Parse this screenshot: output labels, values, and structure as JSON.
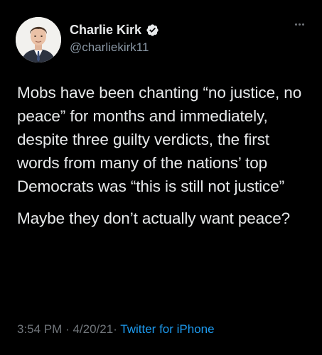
{
  "author": {
    "display_name": "Charlie Kirk",
    "handle": "@charliekirk11",
    "verified": true
  },
  "tweet": {
    "paragraphs": [
      "Mobs have been chanting “no justice, no peace” for months and immediately, despite three guilty verdicts, the first words from many of the nations’ top Democrats was “this is still not justice”",
      "Maybe they don’t actually want peace?"
    ],
    "time": "3:54 PM",
    "date": "4/20/21",
    "separator": "·",
    "source": "Twitter for iPhone"
  },
  "icons": {
    "verified": "verified-badge-icon",
    "more": "more-options-icon"
  },
  "colors": {
    "background": "#000000",
    "primary_text": "#e7e9ea",
    "secondary_text": "#71767b",
    "link": "#1d9bf0"
  }
}
